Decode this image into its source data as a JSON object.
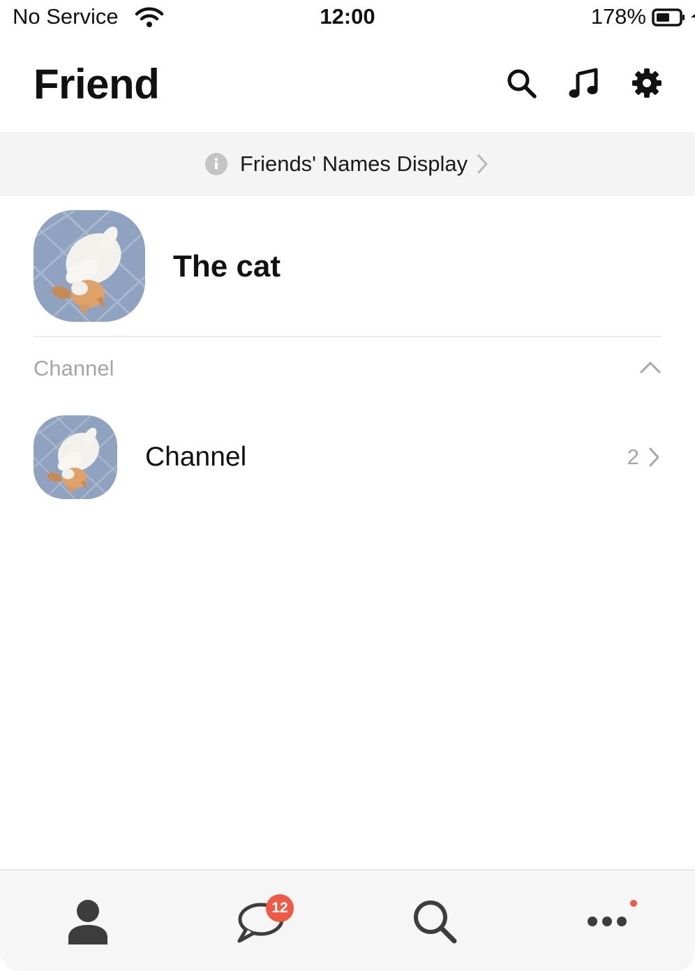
{
  "status_bar": {
    "carrier": "No Service",
    "time": "12:00",
    "battery": "178%"
  },
  "header": {
    "title": "Friend",
    "icons": [
      "search-icon",
      "music-note-icon",
      "gear-icon"
    ]
  },
  "banner": {
    "text": "Friends' Names Display"
  },
  "profile": {
    "name": "The cat"
  },
  "channel_section": {
    "title": "Channel",
    "items": [
      {
        "label": "Channel",
        "count": "2"
      }
    ]
  },
  "tab_bar": {
    "tabs": [
      {
        "icon": "person-icon"
      },
      {
        "icon": "chat-bubble-icon",
        "badge": "12"
      },
      {
        "icon": "search-icon"
      },
      {
        "icon": "more-dots-icon"
      }
    ]
  },
  "colors": {
    "badge": "#ef5a45",
    "banner_bg": "#f4f4f4",
    "tab_bar_bg": "#f6f6f6",
    "muted_text": "#a6a6a6",
    "icon_dark": "#3d3d3d"
  }
}
